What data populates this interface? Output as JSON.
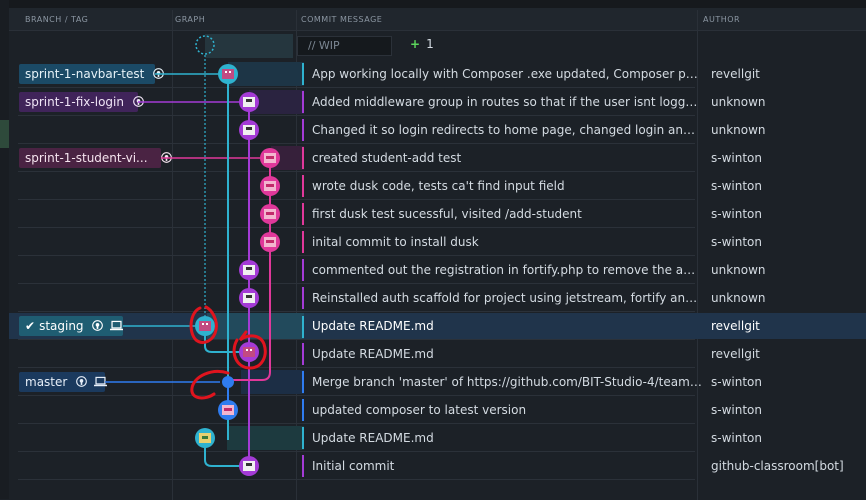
{
  "header": {
    "branch_tag": "BRANCH / TAG",
    "graph": "GRAPH",
    "commit_message": "COMMIT MESSAGE",
    "author": "AUTHOR"
  },
  "wip": {
    "placeholder": "// WIP",
    "count": "1",
    "plus": "+"
  },
  "branches": {
    "navbar": "sprint-1-navbar-test",
    "login": "sprint-1-fix-login",
    "student": "sprint-1-student-vi...",
    "staging": "staging",
    "master": "master"
  },
  "commits": [
    {
      "message": "App working locally with Composer .exe updated, Composer packa...",
      "author": "revellgit"
    },
    {
      "message": "Added middleware group in routes so that if the user isnt logged i...",
      "author": "unknown"
    },
    {
      "message": "Changed it so login redirects to home page, changed login and log...",
      "author": "unknown"
    },
    {
      "message": "created student-add test",
      "author": "s-winton"
    },
    {
      "message": "wrote dusk code, tests ca't find input field",
      "author": "s-winton"
    },
    {
      "message": "first dusk test sucessful, visited /add-student",
      "author": "s-winton"
    },
    {
      "message": "inital commit to install dusk",
      "author": "s-winton"
    },
    {
      "message": "commented out the registration in fortify.php to remove the abilit...",
      "author": "unknown"
    },
    {
      "message": "Reinstalled auth scaffold for project using jetstream, fortify and liv...",
      "author": "unknown"
    },
    {
      "message": "Update README.md",
      "author": "revellgit"
    },
    {
      "message": "Update README.md",
      "author": "revellgit"
    },
    {
      "message": "Merge branch 'master' of https://github.com/BIT-Studio-4/team-pr...",
      "author": "s-winton"
    },
    {
      "message": "updated composer to latest version",
      "author": "s-winton"
    },
    {
      "message": "Update README.md",
      "author": "s-winton"
    },
    {
      "message": "Initial commit",
      "author": "github-classroom[bot]"
    }
  ],
  "colors": {
    "cyan": "#2fb2cf",
    "purple": "#a43bd6",
    "magenta": "#e0389a",
    "annotation": "#e0141e",
    "selected": "#20344b"
  }
}
